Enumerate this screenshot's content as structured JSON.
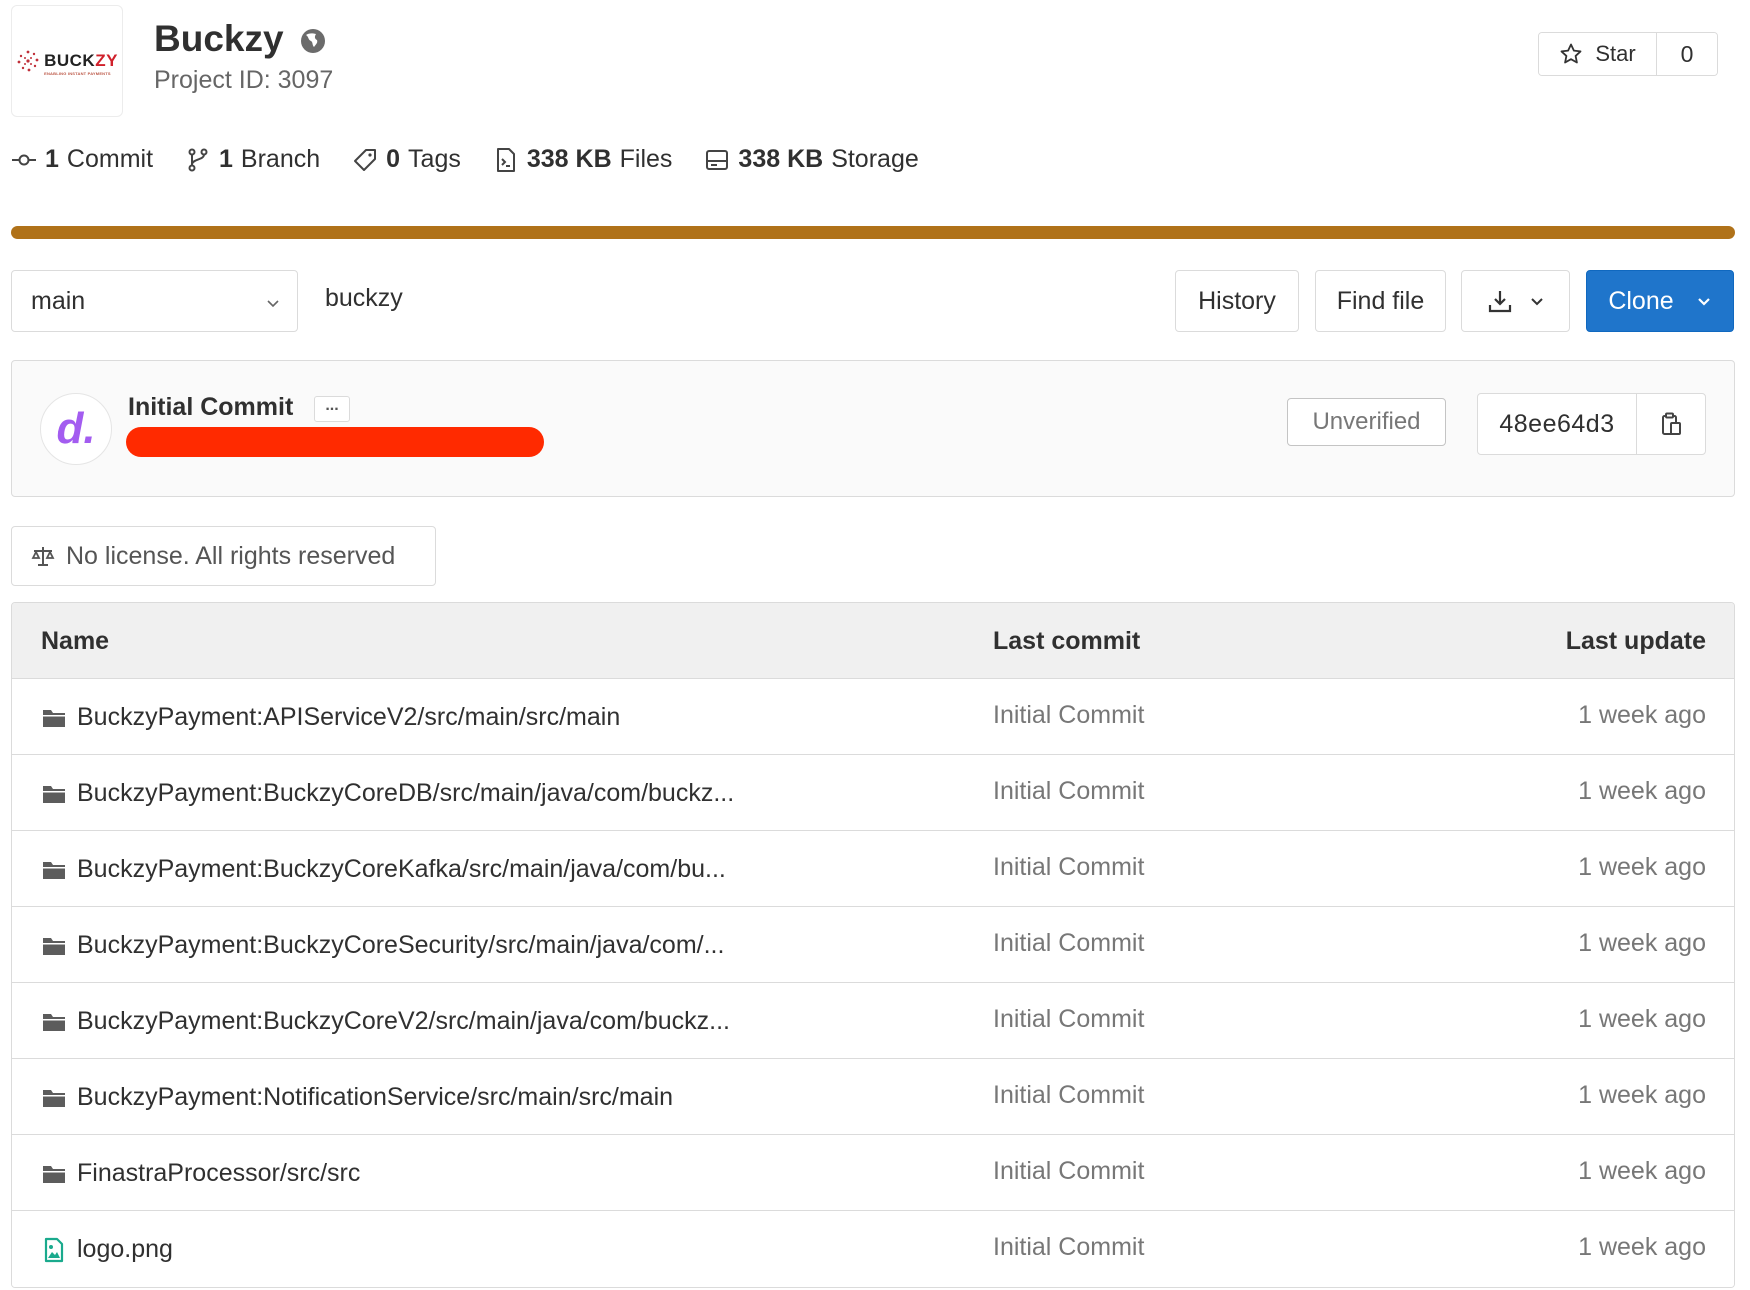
{
  "project": {
    "logo_text_main": "BUCK",
    "logo_text_accent": "ZY",
    "logo_tagline": "ENABLING INSTANT PAYMENTS",
    "name": "Buckzy",
    "project_id": "Project ID: 3097",
    "visibility_icon": "globe-icon"
  },
  "star": {
    "label": "Star",
    "count": "0"
  },
  "stats": [
    {
      "icon": "commit-icon",
      "count": "1",
      "label": "Commit"
    },
    {
      "icon": "branch-icon",
      "count": "1",
      "label": "Branch"
    },
    {
      "icon": "tag-icon",
      "count": "0",
      "label": "Tags"
    },
    {
      "icon": "file-icon",
      "count": "338 KB",
      "label": "Files"
    },
    {
      "icon": "storage-icon",
      "count": "338 KB",
      "label": "Storage"
    }
  ],
  "colors": {
    "language_bar": "#b07219",
    "clone_button": "#1f75cb",
    "avatar_letter": "#a35cf0",
    "redaction": "#ff2a00"
  },
  "toolbar": {
    "branch": "main",
    "breadcrumb": "buckzy",
    "history": "History",
    "find_file": "Find file",
    "clone": "Clone"
  },
  "commit": {
    "avatar_letter": "d.",
    "title": "Initial Commit",
    "ellipsis": "...",
    "signature_status": "Unverified",
    "sha": "48ee64d3"
  },
  "license": {
    "text": "No license. All rights reserved"
  },
  "table": {
    "headers": {
      "name": "Name",
      "last_commit": "Last commit",
      "last_update": "Last update"
    },
    "rows": [
      {
        "type": "folder",
        "name": "BuckzyPayment:APIServiceV2/src/main/src/main",
        "commit": "Initial Commit",
        "updated": "1 week ago"
      },
      {
        "type": "folder",
        "name": "BuckzyPayment:BuckzyCoreDB/src/main/java/com/buckz...",
        "commit": "Initial Commit",
        "updated": "1 week ago"
      },
      {
        "type": "folder",
        "name": "BuckzyPayment:BuckzyCoreKafka/src/main/java/com/bu...",
        "commit": "Initial Commit",
        "updated": "1 week ago"
      },
      {
        "type": "folder",
        "name": "BuckzyPayment:BuckzyCoreSecurity/src/main/java/com/...",
        "commit": "Initial Commit",
        "updated": "1 week ago"
      },
      {
        "type": "folder",
        "name": "BuckzyPayment:BuckzyCoreV2/src/main/java/com/buckz...",
        "commit": "Initial Commit",
        "updated": "1 week ago"
      },
      {
        "type": "folder",
        "name": "BuckzyPayment:NotificationService/src/main/src/main",
        "commit": "Initial Commit",
        "updated": "1 week ago"
      },
      {
        "type": "folder",
        "name": "FinastraProcessor/src/src",
        "commit": "Initial Commit",
        "updated": "1 week ago"
      },
      {
        "type": "image",
        "name": "logo.png",
        "commit": "Initial Commit",
        "updated": "1 week ago"
      }
    ]
  }
}
